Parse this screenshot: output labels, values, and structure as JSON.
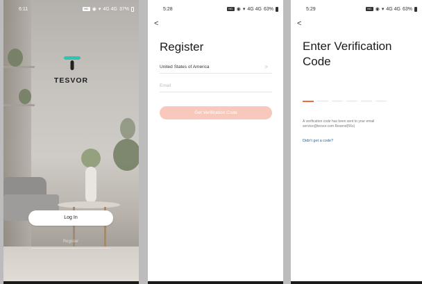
{
  "screen1": {
    "status_time": "6:11",
    "status_battery": "37%",
    "status_hd": "HD",
    "status_net": "4G 4G",
    "brand": "TESVOR",
    "login_label": "Log In",
    "register_label": "Register",
    "accent_color": "#2ec4b6"
  },
  "screen2": {
    "status_time": "5:28",
    "status_battery": "63%",
    "status_hd": "HD",
    "status_net": "4G 4G",
    "back": "<",
    "title": "Register",
    "country_value": "United States of America",
    "country_chevron": ">",
    "email_placeholder": "Email",
    "get_code_label": "Get Verification Code",
    "button_color": "#f9c8bd"
  },
  "screen3": {
    "status_time": "5:29",
    "status_battery": "63%",
    "status_hd": "HD",
    "status_net": "4G 4G",
    "back": "<",
    "title_line1": "Enter Verification",
    "title_line2": "Code",
    "code_slots": 6,
    "info_line1": "A verification code has been sent to your email",
    "info_line2": "service@tesvor.com  Resend(56s)",
    "didnt_get": "Didn't get a code?",
    "accent_color": "#f2683e"
  }
}
